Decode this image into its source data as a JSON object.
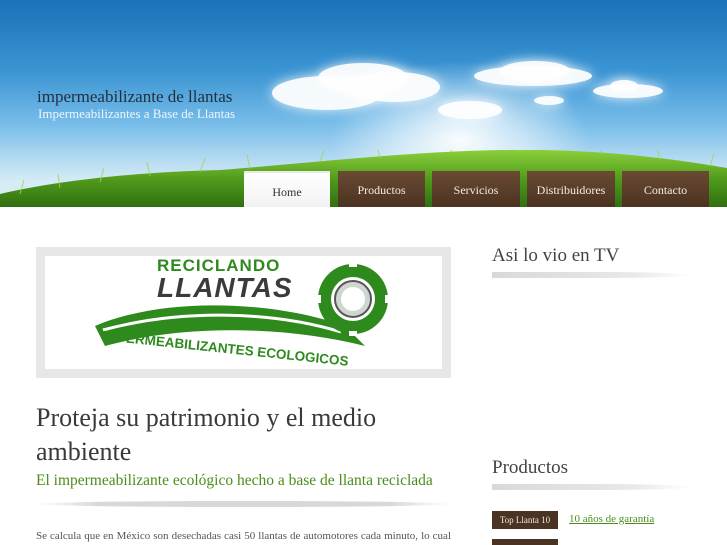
{
  "header": {
    "site_title": "impermeabilizante de llantas",
    "tagline": "Impermeabilizantes a Base de Llantas"
  },
  "nav": {
    "items": [
      {
        "label": "Home",
        "active": true
      },
      {
        "label": "Productos",
        "active": false
      },
      {
        "label": "Servicios",
        "active": false
      },
      {
        "label": "Distribuidores",
        "active": false
      },
      {
        "label": "Contacto",
        "active": false
      }
    ]
  },
  "banner": {
    "line1": "RECICLANDO",
    "line2": "LLANTAS",
    "line3": "IMPERMEABILIZANTES ECOLOGICOS"
  },
  "main": {
    "heading": "Proteja su patrimonio y el medio ambiente",
    "subheading": "El impermeabilizante ecológico hecho a base de llanta reciclada",
    "body": "Se calcula que en México son desechadas casi 50 llantas de automotores cada minuto, lo cual"
  },
  "sidebar": {
    "tv_heading": "Asi lo vio en TV",
    "products_heading": "Productos",
    "products": [
      {
        "tag": "Top Llanta 10",
        "link": "10 años de garantía"
      }
    ]
  },
  "colors": {
    "nav_bg": "#4b3321",
    "accent_green": "#4a8d1b",
    "sky_top": "#1a72b8"
  }
}
